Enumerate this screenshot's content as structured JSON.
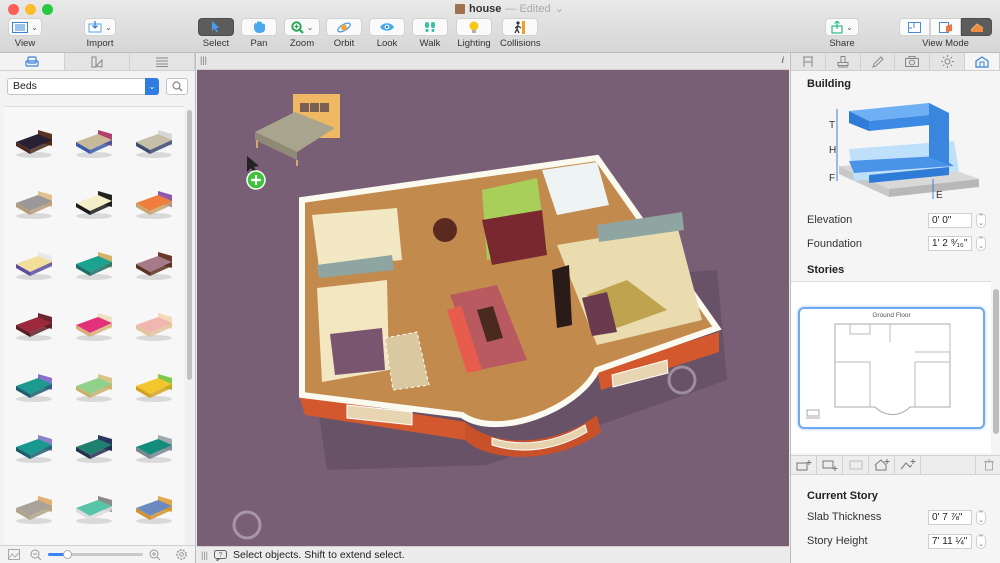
{
  "window": {
    "title": "house",
    "title_suffix": "— Edited",
    "title_chevron": "⌄"
  },
  "toolbar": {
    "left": [
      {
        "id": "view",
        "label": "View",
        "icon": "view-layout-icon",
        "has_menu": true
      },
      {
        "id": "import",
        "label": "Import",
        "icon": "import-icon",
        "has_menu": true
      }
    ],
    "tools": [
      {
        "id": "select",
        "label": "Select",
        "icon": "cursor-arrow-icon",
        "active": true
      },
      {
        "id": "pan",
        "label": "Pan",
        "icon": "hand-icon",
        "active": false
      },
      {
        "id": "zoom",
        "label": "Zoom",
        "icon": "magnifier-icon",
        "active": false,
        "has_menu": true
      },
      {
        "id": "orbit",
        "label": "Orbit",
        "icon": "orbit-icon",
        "active": false
      },
      {
        "id": "look",
        "label": "Look",
        "icon": "eye-icon",
        "active": false
      },
      {
        "id": "walk",
        "label": "Walk",
        "icon": "footprints-icon",
        "active": false
      },
      {
        "id": "lighting",
        "label": "Lighting",
        "icon": "lightbulb-icon",
        "active": false
      },
      {
        "id": "collisions",
        "label": "Collisions",
        "icon": "walking-person-icon",
        "active": false
      }
    ],
    "share": {
      "label": "Share",
      "icon": "share-icon",
      "has_menu": true
    },
    "view_mode": {
      "label": "View Mode",
      "options": [
        "2D plan",
        "2D/3D split",
        "3D"
      ],
      "selected": "3D"
    }
  },
  "library": {
    "tabs": [
      {
        "id": "furniture",
        "icon": "armchair-icon",
        "active": true
      },
      {
        "id": "materials",
        "icon": "paint-swatch-icon",
        "active": false
      },
      {
        "id": "list",
        "icon": "list-icon",
        "active": false
      }
    ],
    "category": "Beds",
    "search_icon": "search-icon",
    "items": [
      {
        "name": "bed-dark-wood",
        "frame": "#4a2a1a",
        "sheet": "#2a2036",
        "head": "#5a3422"
      },
      {
        "name": "bed-blue-beige",
        "frame": "#3b5aa8",
        "sheet": "#c9b99b",
        "head": "#b0406e"
      },
      {
        "name": "bed-grey-pillows",
        "frame": "#3c4a70",
        "sheet": "#c7bfa8",
        "head": "#d7d7d7"
      },
      {
        "name": "bed-grey-wood",
        "frame": "#b59a7a",
        "sheet": "#9a9898",
        "head": "#e2c28f"
      },
      {
        "name": "bed-black-cream",
        "frame": "#1a1a1a",
        "sheet": "#f4efc8",
        "head": "#222222"
      },
      {
        "name": "bed-orange-purple",
        "frame": "#c9a36d",
        "sheet": "#f07e3c",
        "head": "#8e5ab0"
      },
      {
        "name": "bed-yellow-purple",
        "frame": "#5a4aa0",
        "sheet": "#f1df9a",
        "head": "#e8e8e8"
      },
      {
        "name": "bed-teal",
        "frame": "#1b6e68",
        "sheet": "#1aa38f",
        "head": "#d6b36a"
      },
      {
        "name": "bed-mauve",
        "frame": "#5a3325",
        "sheet": "#a67a87",
        "head": "#6a3a2a"
      },
      {
        "name": "bed-maroon",
        "frame": "#5a1d22",
        "sheet": "#9c2a3c",
        "head": "#6d2630"
      },
      {
        "name": "bed-pink",
        "frame": "#d8b07a",
        "sheet": "#e2317a",
        "head": "#efe0c0"
      },
      {
        "name": "bed-peach",
        "frame": "#e0c49a",
        "sheet": "#f1b6b0",
        "head": "#f3d9b8"
      },
      {
        "name": "bed-teal-purple",
        "frame": "#1b5e70",
        "sheet": "#1c9a8f",
        "head": "#8a6fd0"
      },
      {
        "name": "bed-mint-brass",
        "frame": "#c8b06a",
        "sheet": "#8fd08a",
        "head": "#d9c48a"
      },
      {
        "name": "bed-yellow-green",
        "frame": "#d4a220",
        "sheet": "#f2c62c",
        "head": "#7dc94a"
      },
      {
        "name": "bed-teal-lavender",
        "frame": "#1b5e70",
        "sheet": "#18988f",
        "head": "#8c82c9"
      },
      {
        "name": "bed-green-navy",
        "frame": "#26304f",
        "sheet": "#1f8070",
        "head": "#2b3560"
      },
      {
        "name": "bed-teal-iron",
        "frame": "#7a8590",
        "sheet": "#138c7c",
        "head": "#a0a8b0"
      },
      {
        "name": "bed-grey-wood-panel",
        "frame": "#b0a48a",
        "sheet": "#a8a29a",
        "head": "#e0b070"
      },
      {
        "name": "bed-round-aqua",
        "frame": "#dddddd",
        "sheet": "#58c4a8",
        "head": "#8a8a8a"
      },
      {
        "name": "bed-oak-blue",
        "frame": "#d2932e",
        "sheet": "#6c8ac0",
        "head": "#e2a848"
      }
    ],
    "zoom_slider": {
      "value": 0.2
    },
    "bottom_icons": [
      "image-icon",
      "zoom-out-icon",
      "zoom-in-icon",
      "gear-icon"
    ]
  },
  "canvas": {
    "background": "#785f75",
    "drag_preview": "bed-oak-headboard",
    "add_badge": "+",
    "info_icon": "i"
  },
  "status": {
    "icon": "help-bubble-icon",
    "message": "Select objects. Shift to extend select."
  },
  "inspector": {
    "tabs": [
      {
        "id": "wall",
        "icon": "column-icon",
        "active": false
      },
      {
        "id": "stamp",
        "icon": "stamp-icon",
        "active": false
      },
      {
        "id": "pencil",
        "icon": "pencil-icon",
        "active": false
      },
      {
        "id": "camera",
        "icon": "camera-icon",
        "active": false
      },
      {
        "id": "sun",
        "icon": "sun-icon",
        "active": false
      },
      {
        "id": "building",
        "icon": "house-icon",
        "active": true
      }
    ],
    "building": {
      "title": "Building",
      "diagram_labels": {
        "T": "T",
        "H": "H",
        "F": "F",
        "E": "E"
      },
      "elevation": {
        "label": "Elevation",
        "value": "0' 0\""
      },
      "foundation": {
        "label": "Foundation",
        "value": "1' 2 ⁹⁄₁₆\""
      }
    },
    "stories": {
      "title": "Stories",
      "items": [
        {
          "name": "Ground Floor",
          "selected": true
        }
      ],
      "actions": [
        "add-story-above-icon",
        "add-story-below-icon",
        "story-icon",
        "add-roof-icon",
        "add-terrain-icon",
        "trash-icon"
      ]
    },
    "current_story": {
      "title": "Current Story",
      "slab_thickness": {
        "label": "Slab Thickness",
        "value": "0' 7 ⅞\""
      },
      "story_height": {
        "label": "Story Height",
        "value": "7' 11 ¼\""
      }
    }
  }
}
